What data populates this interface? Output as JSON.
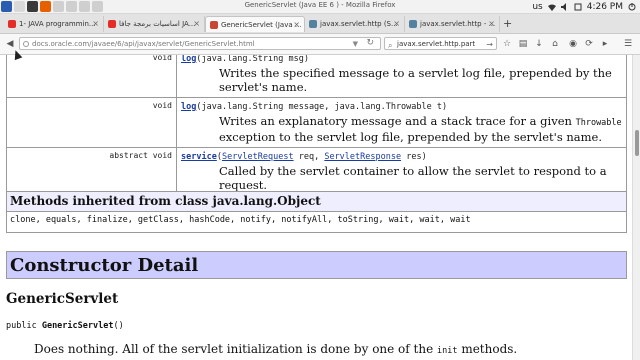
{
  "window": {
    "title": "GenericServlet (Java EE 6 ) - Mozilla Firefox"
  },
  "system_tray": {
    "keyboard_layout": "us",
    "time": "4:26 PM"
  },
  "tabs": [
    {
      "label": "1- JAVA programmin...",
      "favicon": "youtube-icon",
      "color": "#e52d27"
    },
    {
      "label": "اساسيات برمجة جافا JA...",
      "favicon": "youtube-icon",
      "color": "#e52d27"
    },
    {
      "label": "GenericServlet (Java ...",
      "favicon": "oracle-icon",
      "color": "#c74634",
      "active": true
    },
    {
      "label": "javax.servlet.http (S...",
      "favicon": "java-icon",
      "color": "#5382a1"
    },
    {
      "label": "javax.servlet.http - ...",
      "favicon": "java-icon",
      "color": "#5382a1"
    }
  ],
  "navbar": {
    "url": "docs.oracle.com/javaee/6/api/javax/servlet/GenericServlet.html",
    "search_value": "javax.servlet.http.part"
  },
  "methods": [
    {
      "modifier": "void",
      "name": "log",
      "params": "(java.lang.String msg)",
      "description": "Writes the specified message to a servlet log file, prepended by the servlet's name."
    },
    {
      "modifier": "void",
      "name": "log",
      "params": "(java.lang.String message, java.lang.Throwable t)",
      "description_pre": "Writes an explanatory message and a stack trace for a given ",
      "description_code": "Throwable",
      "description_post": " exception to the servlet log file, prepended by the servlet's name."
    },
    {
      "modifier": "abstract  void",
      "name": "service",
      "param_open": "(",
      "param1_type": "ServletRequest",
      "param1_name": " req, ",
      "param2_type": "ServletResponse",
      "param2_name": " res)",
      "description": "Called by the servlet container to allow the servlet to respond to a request."
    }
  ],
  "inherited": {
    "heading": "Methods inherited from class java.lang.Object",
    "list": "clone, equals, finalize, getClass, hashCode, notify, notifyAll, toString, wait, wait, wait"
  },
  "constructor_detail": {
    "heading": "Constructor Detail",
    "name": "GenericServlet",
    "sig_prefix": "public ",
    "sig_name": "GenericServlet",
    "sig_suffix": "()",
    "desc_pre": "Does nothing. All of the servlet initialization is done by one of the ",
    "desc_code": "init",
    "desc_post": " methods."
  }
}
